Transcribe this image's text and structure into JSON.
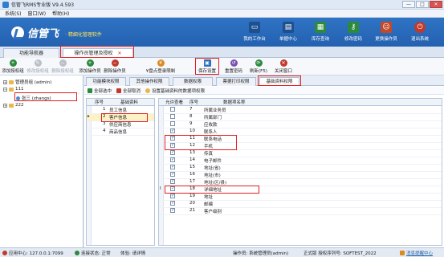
{
  "window": {
    "title": "信管飞RMS专业版 V9.4.593",
    "minimize": "—",
    "maximize": "□",
    "close": "✕"
  },
  "menu": [
    "系统(S)",
    "窗口(W)",
    "帮助(H)"
  ],
  "banner": {
    "logo_text": "信管飞",
    "logo_sub": "· 精细化管理软件",
    "buttons": [
      {
        "label": "我的工作台",
        "icon": "monitor-icon",
        "color": "#1e4f8f"
      },
      {
        "label": "单据中心",
        "icon": "documents-icon",
        "color": "#1e4f8f"
      },
      {
        "label": "库存查询",
        "icon": "warehouse-icon",
        "color": "#2c8a3c"
      },
      {
        "label": "修改密码",
        "icon": "key-icon",
        "color": "#2c8a3c"
      },
      {
        "label": "更换操作员",
        "icon": "user-switch-icon",
        "color": "#c24a2b"
      },
      {
        "label": "退出系统",
        "icon": "exit-icon",
        "color": "#c0392b"
      }
    ]
  },
  "tabs": [
    {
      "label": "功能导航器",
      "active": false
    },
    {
      "label": "操作员管理及授权",
      "active": true,
      "close": "✕"
    }
  ],
  "toolbar": [
    {
      "label": "添加授权组",
      "color": "#2c8a3c",
      "disabled": false,
      "glyph": "+"
    },
    {
      "label": "修改授权组",
      "color": "#4a8bd6",
      "disabled": true,
      "glyph": "✎"
    },
    {
      "label": "删除授权组",
      "color": "#c0392b",
      "disabled": true,
      "glyph": "−"
    },
    {
      "label": "添加操作员",
      "color": "#2c8a3c",
      "disabled": false,
      "glyph": "+"
    },
    {
      "label": "删除操作员",
      "color": "#c0392b",
      "disabled": false,
      "glyph": "−"
    },
    {
      "label": "¥盘点登录限制",
      "color": "#d98b1f",
      "disabled": false,
      "glyph": "¥"
    },
    {
      "label": "保存设置",
      "color": "#2e6fbd",
      "disabled": false,
      "glyph": "▣"
    },
    {
      "label": "重置密码",
      "color": "#7b4fb3",
      "disabled": false,
      "glyph": "↺"
    },
    {
      "label": "刷新(F5)",
      "color": "#2c8a3c",
      "disabled": false,
      "glyph": "⟳"
    },
    {
      "label": "关闭窗口",
      "color": "#c0392b",
      "disabled": false,
      "glyph": "✕"
    }
  ],
  "tree": {
    "root": "管理员组 (admin)",
    "group1": "111",
    "user_selected": "张三 (zhangs)",
    "group2": "222"
  },
  "subtabs": [
    "功能模块权限",
    "其他操作权限",
    "数据权限",
    "票据打印权限",
    "基础资料权限"
  ],
  "subtoolbar": {
    "select_all": "全部选中",
    "cancel_all": "全部取消",
    "hint": "设置基础资料的数据项权限"
  },
  "left_grid": {
    "headers": [
      "序号",
      "基础资料"
    ],
    "rows": [
      {
        "no": "1",
        "name": "员工信息"
      },
      {
        "no": "2",
        "name": "客户信息"
      },
      {
        "no": "3",
        "name": "供应商信息"
      },
      {
        "no": "4",
        "name": "商品信息"
      }
    ]
  },
  "right_grid": {
    "headers": [
      "允许查看",
      "序号",
      "数据项名称"
    ],
    "rows": [
      {
        "checked": false,
        "no": "7",
        "name": "所属业务员"
      },
      {
        "checked": false,
        "no": "8",
        "name": "所属部门"
      },
      {
        "checked": false,
        "no": "9",
        "name": "应收款"
      },
      {
        "checked": true,
        "no": "10",
        "name": "联系人"
      },
      {
        "checked": true,
        "no": "11",
        "name": "联系电话"
      },
      {
        "checked": true,
        "no": "12",
        "name": "手机"
      },
      {
        "checked": true,
        "no": "13",
        "name": "传真"
      },
      {
        "checked": true,
        "no": "14",
        "name": "电子邮件"
      },
      {
        "checked": true,
        "no": "15",
        "name": "地址(省)"
      },
      {
        "checked": true,
        "no": "16",
        "name": "地址(市)"
      },
      {
        "checked": true,
        "no": "17",
        "name": "地址(区/县)"
      },
      {
        "checked": true,
        "no": "18",
        "name": "详细地址"
      },
      {
        "checked": true,
        "no": "19",
        "name": "地址"
      },
      {
        "checked": true,
        "no": "20",
        "name": "邮编"
      },
      {
        "checked": true,
        "no": "21",
        "name": "客户级别"
      }
    ]
  },
  "statusbar": {
    "server": "应用中心: 127.0.0.1:7099",
    "connection": "连接状态: 正常",
    "version": "体验: 请详情",
    "operator": "操作员: 系统管理员(admin)",
    "edition": "正式版 授权序列号: SOFTEST_2022",
    "message": "消息提醒中心"
  }
}
